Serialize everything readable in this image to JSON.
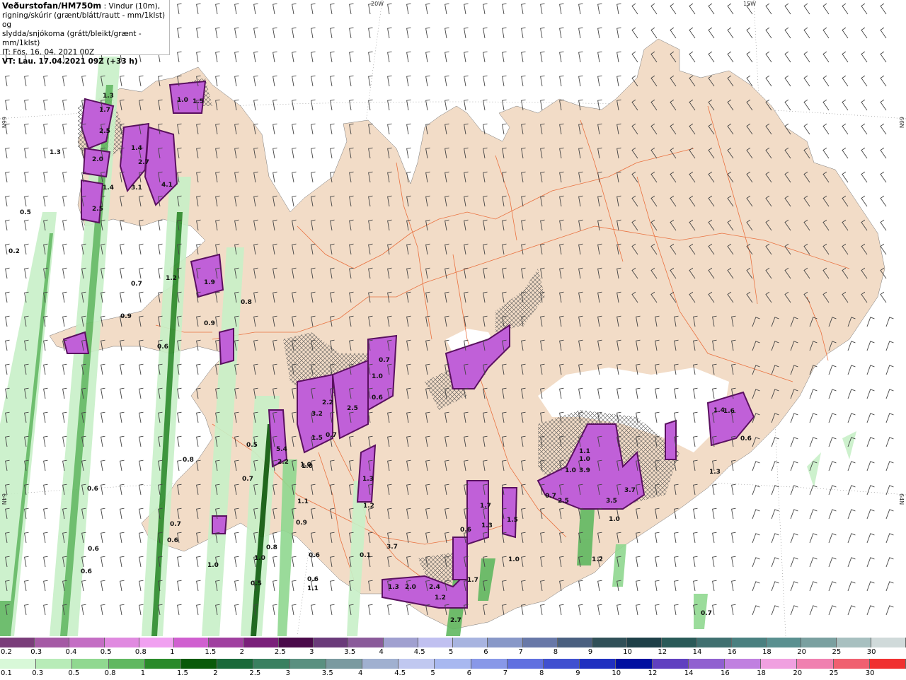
{
  "header": {
    "title": "Veðurstofan/HM750m",
    "subtitle_1": " : Vindur (10m),",
    "line2": "rigning/skúrir (grænt/blátt/rautt - mm/1klst) og",
    "line3": "slydda/snjókoma (grátt/bleikt/grænt - mm/1klst)",
    "line4": "IT: Fös. 16. 04. 2021 00Z",
    "line5": "VT: Lau. 17.04.2021 09Z (+33 h)"
  },
  "graticule": {
    "lon_20w": "20W",
    "lon_15w": "15W",
    "lat_66n_left": "66N",
    "lat_66n_right": "66N",
    "lat_64n_left": "64N",
    "lat_64n_right": "64N"
  },
  "scale_snow": {
    "labels": [
      "0.2",
      "0.3",
      "0.4",
      "0.5",
      "0.8",
      "1",
      "1.5",
      "2",
      "2.5",
      "3",
      "3.5",
      "4",
      "4.5",
      "5",
      "6",
      "7",
      "8",
      "9",
      "10",
      "12",
      "14",
      "16",
      "18",
      "20",
      "25",
      "30"
    ],
    "colors": [
      "#7a3d7a",
      "#a55aa5",
      "#c46ec4",
      "#e08ae0",
      "#f0a0f0",
      "#d060d0",
      "#a040a0",
      "#7a207a",
      "#4a0a4a",
      "#6a3a7a",
      "#8a5a9a",
      "#a0a0d0",
      "#c0c0f0",
      "#a8b4e0",
      "#8898c8",
      "#6878a8",
      "#4a6080",
      "#305058",
      "#1e4048",
      "#2a5a58",
      "#407070",
      "#4a8080",
      "#5a9090",
      "#7aa0a0",
      "#a8c0c0",
      "#d0dada"
    ]
  },
  "scale_rain": {
    "labels": [
      "0.1",
      "0.3",
      "0.5",
      "0.8",
      "1",
      "1.5",
      "2",
      "2.5",
      "3",
      "3.5",
      "4",
      "4.5",
      "5",
      "6",
      "7",
      "8",
      "9",
      "10",
      "12",
      "14",
      "16",
      "18",
      "20",
      "25",
      "30"
    ],
    "colors": [
      "#d8f8d8",
      "#b8ecb8",
      "#90d890",
      "#60b860",
      "#2a8a2a",
      "#0a5a0a",
      "#1a6a3a",
      "#3a8060",
      "#5a9080",
      "#7a9aa0",
      "#a0b0d0",
      "#c0c8f0",
      "#a8b8f0",
      "#8898e8",
      "#6070e0",
      "#4050d0",
      "#2030c0",
      "#0010a0",
      "#6040c0",
      "#9060d0",
      "#c080e0",
      "#f0a0e0",
      "#f080b0",
      "#f06070",
      "#f03030"
    ]
  },
  "map_labels": [
    {
      "t": "1.3"
    },
    {
      "t": "1.7"
    },
    {
      "t": "2.5"
    },
    {
      "t": "2.0"
    },
    {
      "t": "1.4"
    },
    {
      "t": "2.7"
    },
    {
      "t": "3.1"
    },
    {
      "t": "4.1"
    },
    {
      "t": "1.4"
    },
    {
      "t": "2.5"
    },
    {
      "t": "1.0"
    },
    {
      "t": "1.5"
    },
    {
      "t": "1.3"
    },
    {
      "t": "0.5"
    },
    {
      "t": "0.2"
    },
    {
      "t": "1.9"
    },
    {
      "t": "0.7"
    },
    {
      "t": "1.2"
    },
    {
      "t": "0.9"
    },
    {
      "t": "0.8"
    },
    {
      "t": "0.9"
    },
    {
      "t": "0.6"
    },
    {
      "t": "2.2"
    },
    {
      "t": "2.5"
    },
    {
      "t": "3.2"
    },
    {
      "t": "1.5"
    },
    {
      "t": "0.7"
    },
    {
      "t": "0.7"
    },
    {
      "t": "1.0"
    },
    {
      "t": "0.6"
    },
    {
      "t": "1.3"
    },
    {
      "t": "1.0"
    },
    {
      "t": "5.4"
    },
    {
      "t": "2.2"
    },
    {
      "t": "1.0"
    },
    {
      "t": "0.5"
    },
    {
      "t": "0.8"
    },
    {
      "t": "0.7"
    },
    {
      "t": "0.6"
    },
    {
      "t": "0.7"
    },
    {
      "t": "0.6"
    },
    {
      "t": "0.6"
    },
    {
      "t": "0.6"
    },
    {
      "t": "1.0"
    },
    {
      "t": "0.8"
    },
    {
      "t": "1.0"
    },
    {
      "t": "0.5"
    },
    {
      "t": "0.6"
    },
    {
      "t": "0.6"
    },
    {
      "t": "1.1"
    },
    {
      "t": "1.1"
    },
    {
      "t": "0.9"
    },
    {
      "t": "1.2"
    },
    {
      "t": "0.1"
    },
    {
      "t": "3.7"
    },
    {
      "t": "1.3"
    },
    {
      "t": "2.0"
    },
    {
      "t": "2.4"
    },
    {
      "t": "1.2"
    },
    {
      "t": "0.6"
    },
    {
      "t": "1.3"
    },
    {
      "t": "1.7"
    },
    {
      "t": "1.5"
    },
    {
      "t": "1.0"
    },
    {
      "t": "1.1"
    },
    {
      "t": "1.0"
    },
    {
      "t": "3.9"
    },
    {
      "t": "1.0"
    },
    {
      "t": "0.7"
    },
    {
      "t": "2.5"
    },
    {
      "t": "3.5"
    },
    {
      "t": "3.7"
    },
    {
      "t": "1.0"
    },
    {
      "t": "1.2"
    },
    {
      "t": "1.6"
    },
    {
      "t": "0.6"
    },
    {
      "t": "1.3"
    },
    {
      "t": "0.7"
    },
    {
      "t": "1.4"
    },
    {
      "t": "2.7"
    },
    {
      "t": "1.7"
    }
  ],
  "colors": {
    "land": "#f2dcc7",
    "road": "#e8602a",
    "rain_light": "#c8f0c8",
    "rain_mid": "#60b860",
    "rain_dark": "#0a5a0a",
    "snow": "#c060d8",
    "snow_dark": "#5a1060",
    "glacier": "#ffffff",
    "barb": "#444444"
  }
}
